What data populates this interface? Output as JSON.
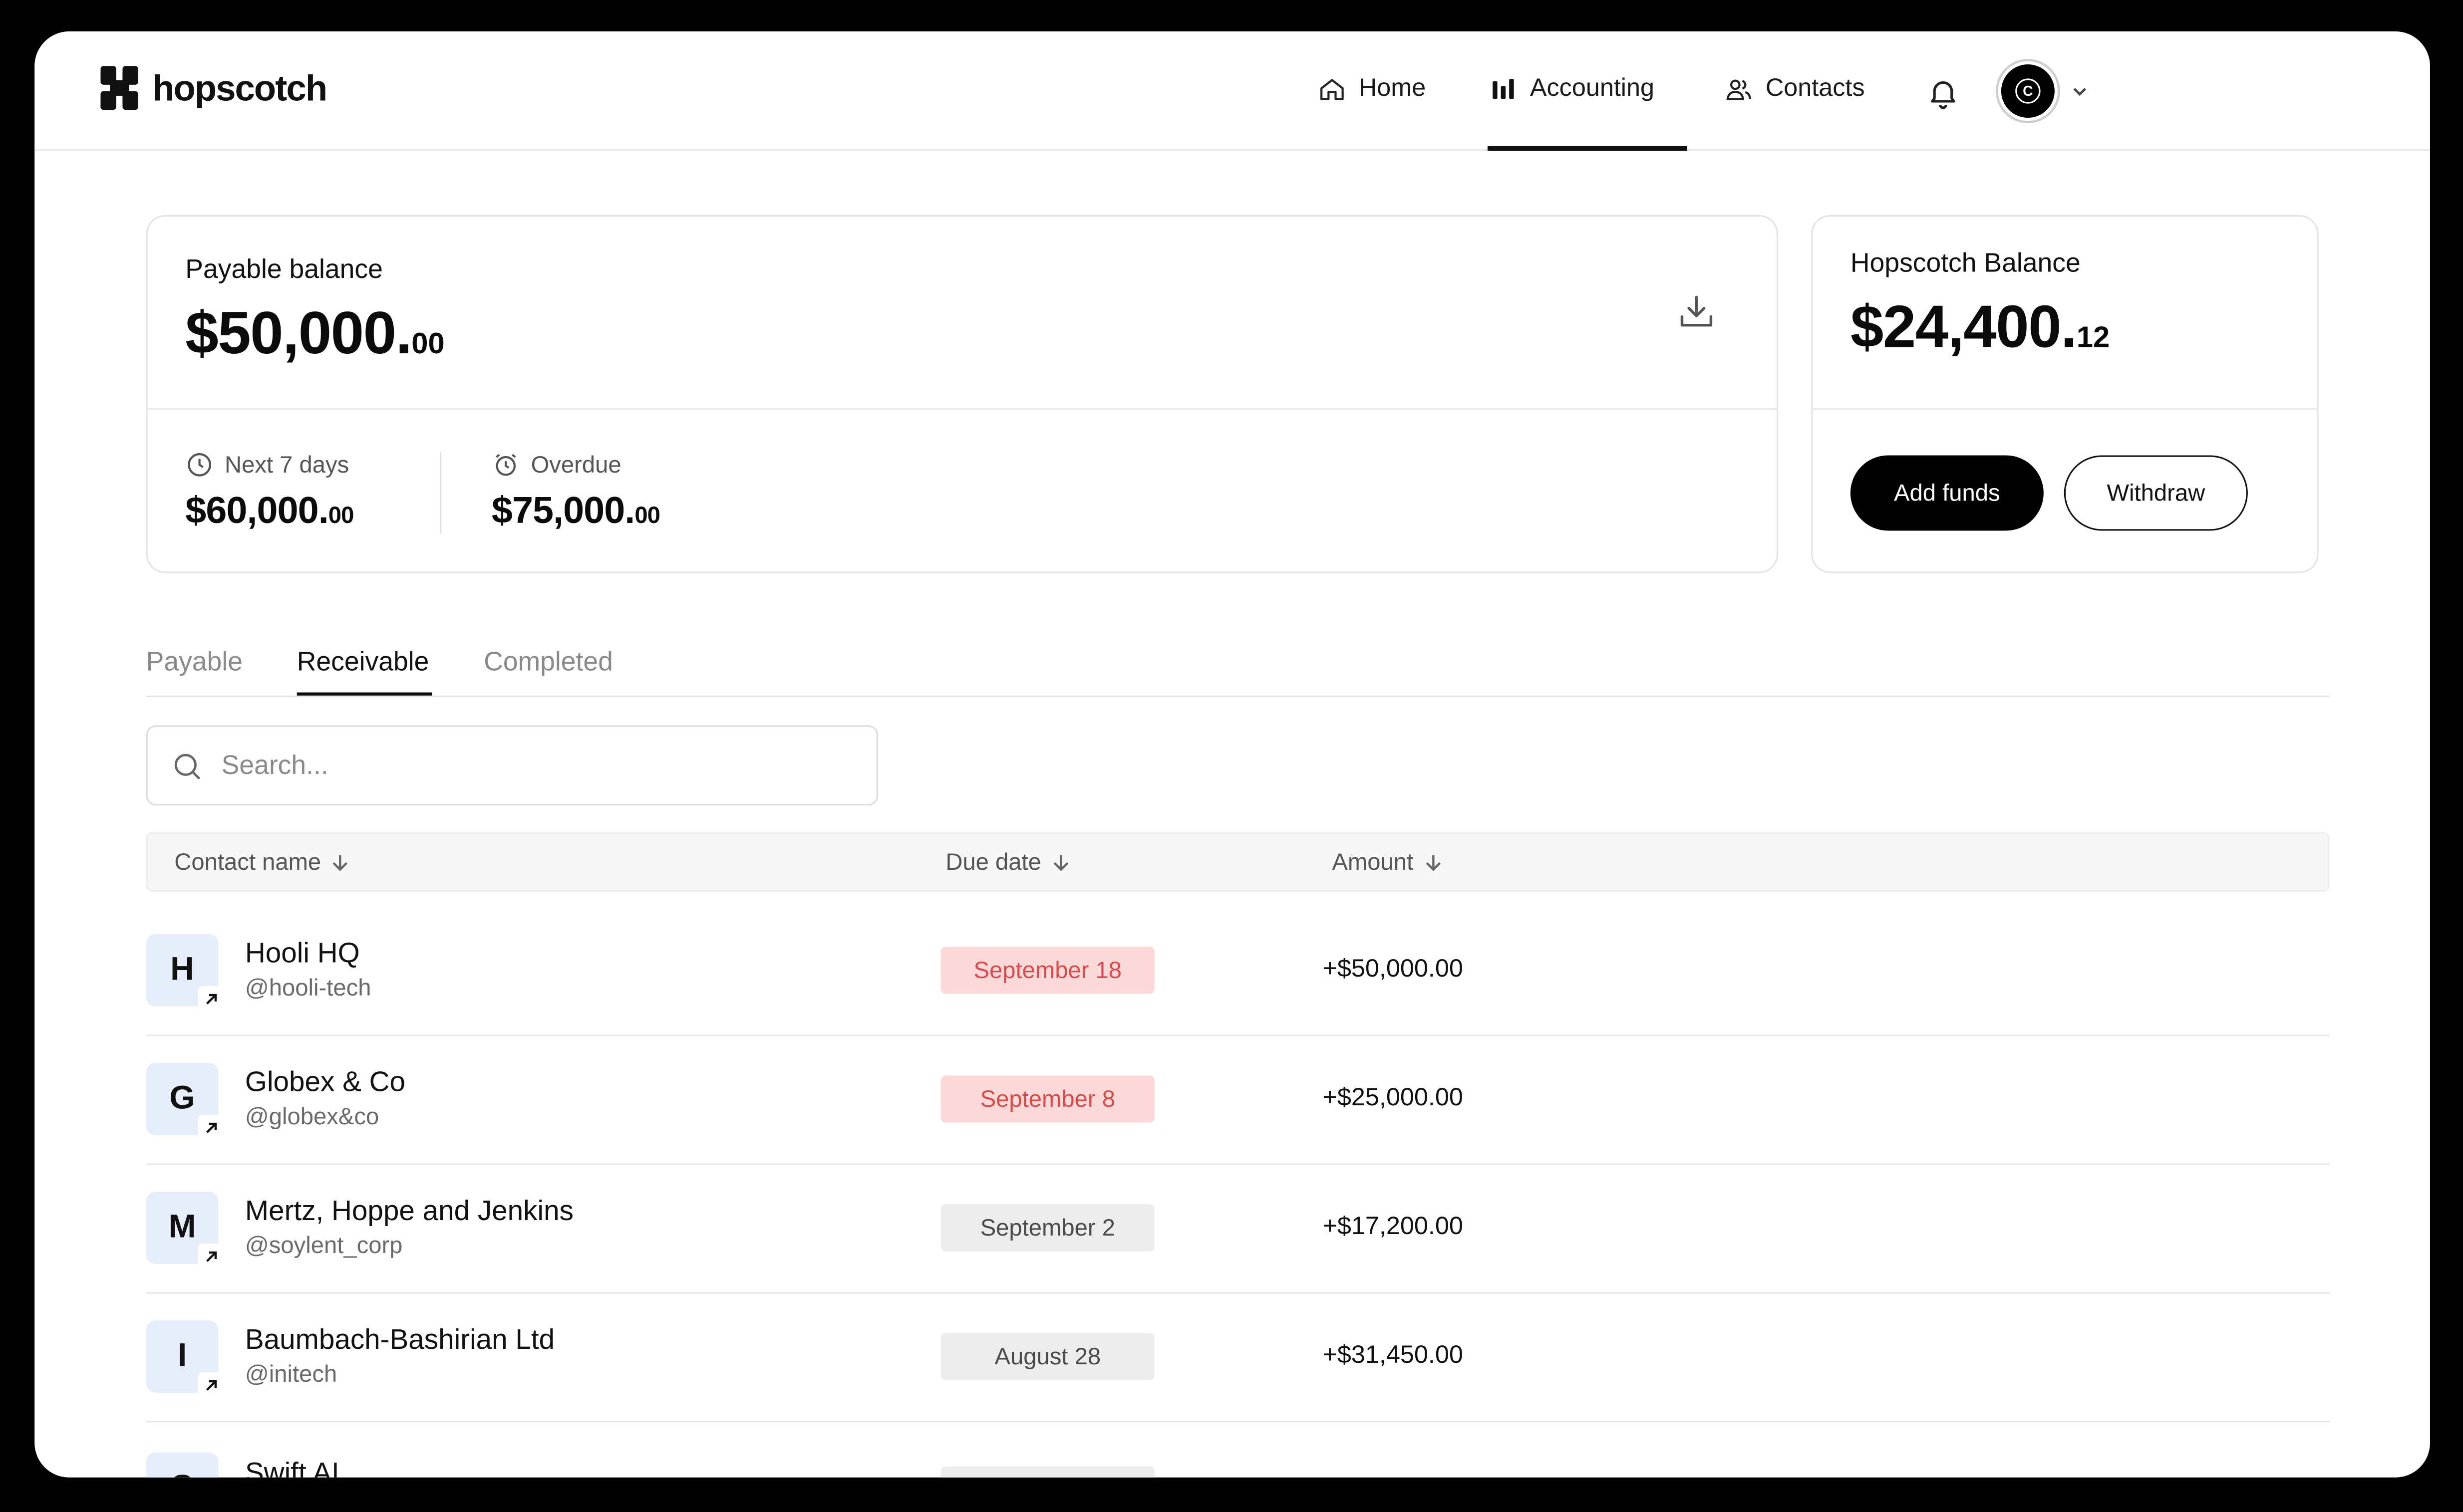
{
  "brand": {
    "name": "hopscotch"
  },
  "nav": {
    "items": [
      {
        "label": "Home",
        "icon": "home-icon"
      },
      {
        "label": "Accounting",
        "icon": "bar-chart-icon",
        "active": true
      },
      {
        "label": "Contacts",
        "icon": "users-icon"
      }
    ],
    "notifications_icon": "bell-icon",
    "avatar_initial": "C"
  },
  "payable_card": {
    "title": "Payable balance",
    "amount_main": "$50,000.",
    "amount_cents": "00",
    "next7": {
      "label": "Next 7 days",
      "amount_main": "$60,000.",
      "amount_cents": "00"
    },
    "overdue": {
      "label": "Overdue",
      "amount_main": "$75,000.",
      "amount_cents": "00"
    }
  },
  "hopscotch_card": {
    "title": "Hopscotch Balance",
    "amount_main": "$24,400.",
    "amount_cents": "12",
    "add_funds": "Add funds",
    "withdraw": "Withdraw"
  },
  "tabs": [
    {
      "label": "Payable"
    },
    {
      "label": "Receivable",
      "active": true
    },
    {
      "label": "Completed"
    }
  ],
  "search": {
    "placeholder": "Search..."
  },
  "table": {
    "headers": {
      "contact": "Contact name",
      "due": "Due date",
      "amount": "Amount"
    },
    "rows": [
      {
        "initial": "H",
        "name": "Hooli HQ",
        "handle": "@hooli-tech",
        "due": "September 18",
        "due_status": "overdue",
        "amount": "+$50,000.00"
      },
      {
        "initial": "G",
        "name": "Globex & Co",
        "handle": "@globex&co",
        "due": "September 8",
        "due_status": "overdue",
        "amount": "+$25,000.00"
      },
      {
        "initial": "M",
        "name": "Mertz, Hoppe and Jenkins",
        "handle": "@soylent_corp",
        "due": "September 2",
        "due_status": "normal",
        "amount": "+$17,200.00"
      },
      {
        "initial": "I",
        "name": "Baumbach-Bashirian Ltd",
        "handle": "@initech",
        "due": "August 28",
        "due_status": "normal",
        "amount": "+$31,450.00"
      },
      {
        "initial": "S",
        "name": "Swift AI"
      }
    ]
  },
  "colors": {
    "overdue_bg": "#fbd9d9",
    "overdue_text": "#d94a4a",
    "avatar_bg": "#e6eefb",
    "primary": "#000000"
  }
}
